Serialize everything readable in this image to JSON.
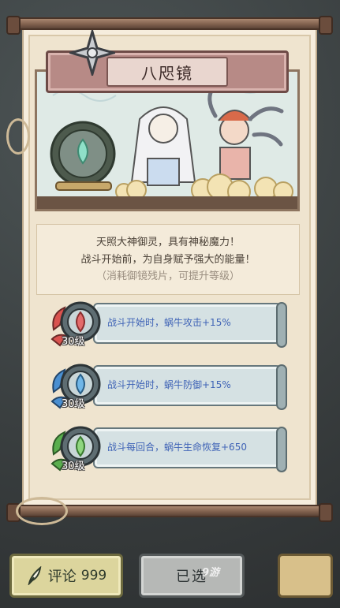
{
  "item": {
    "title": "八咫镜",
    "description_lines": [
      "天照大神御灵，具有神秘魔力！",
      "战斗开始前，为自身赋予强大的能量！"
    ],
    "hint": "（消耗御镜残片，可提升等级）"
  },
  "skills": [
    {
      "level": "30级",
      "text": "战斗开始时，蜗牛攻击+15%",
      "emblem_icon": "red-flame-emblem-icon",
      "color": "#d9534f"
    },
    {
      "level": "30级",
      "text": "战斗开始时，蜗牛防御+15%",
      "emblem_icon": "blue-flame-emblem-icon",
      "color": "#4a8fd1"
    },
    {
      "level": "30级",
      "text": "战斗每回合，蜗牛生命恢复+650",
      "emblem_icon": "green-flame-emblem-icon",
      "color": "#5aae4e"
    }
  ],
  "buttons": {
    "comment_label": "评论",
    "comment_count": "999",
    "selected_label": "已选"
  },
  "watermark": "9游"
}
